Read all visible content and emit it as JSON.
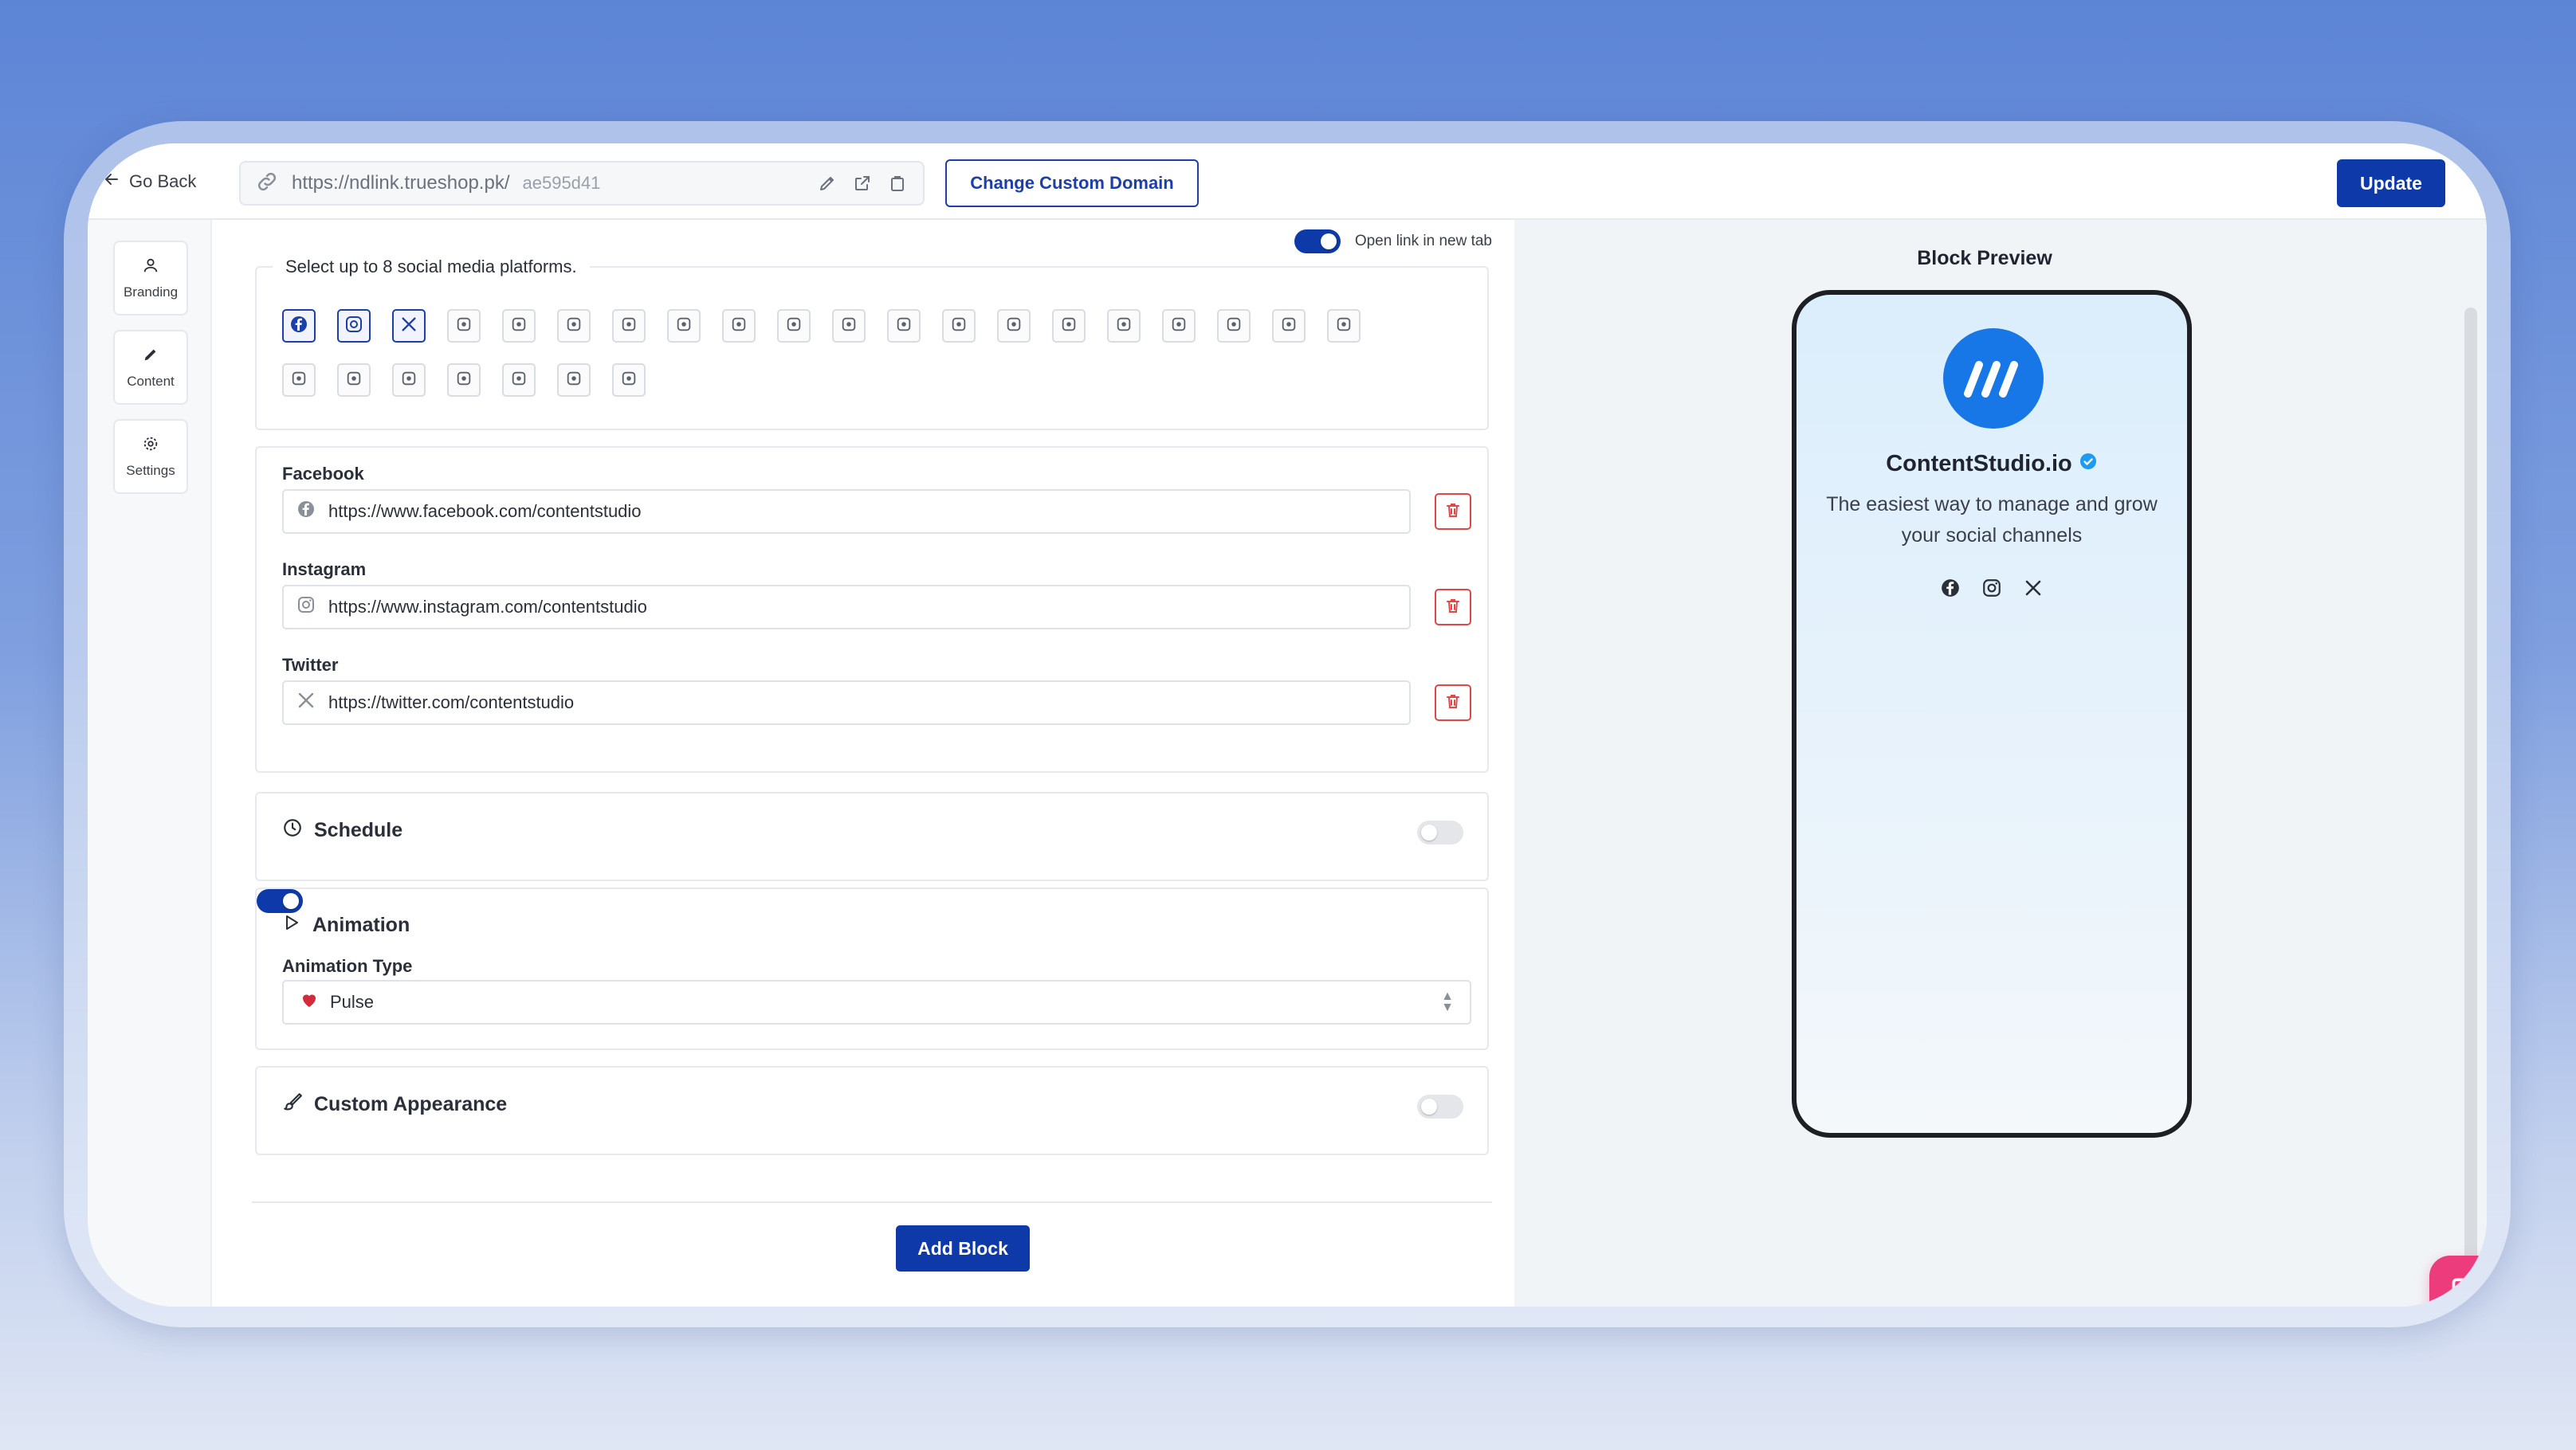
{
  "topbar": {
    "go_back": "Go Back",
    "url_base": "https://ndlink.trueshop.pk/",
    "url_slug": "ae595d41",
    "change_domain": "Change Custom Domain",
    "update": "Update"
  },
  "rail": {
    "items": [
      {
        "label": "Branding",
        "icon": "user-icon"
      },
      {
        "label": "Content",
        "icon": "pencil-icon"
      },
      {
        "label": "Settings",
        "icon": "gear-icon"
      }
    ]
  },
  "editor": {
    "open_new_tab": "Open link in new tab",
    "open_new_tab_on": true,
    "platforms_legend": "Select up to 8 social media platforms.",
    "platforms": [
      {
        "icon": "facebook-icon",
        "selected": true
      },
      {
        "icon": "instagram-icon",
        "selected": true
      },
      {
        "icon": "x-icon",
        "selected": true
      },
      {
        "icon": "linkedin-icon",
        "selected": false
      },
      {
        "icon": "youtube-icon",
        "selected": false
      },
      {
        "icon": "tiktok-icon",
        "selected": false
      },
      {
        "icon": "medium-icon",
        "selected": false
      },
      {
        "icon": "twitch-icon",
        "selected": false
      },
      {
        "icon": "spotify-icon",
        "selected": false
      },
      {
        "icon": "soundcloud-icon",
        "selected": false
      },
      {
        "icon": "apple-icon",
        "selected": false
      },
      {
        "icon": "pinterest-icon",
        "selected": false
      },
      {
        "icon": "snapchat-icon",
        "selected": false
      },
      {
        "icon": "reddit-icon",
        "selected": false
      },
      {
        "icon": "tumblr-icon",
        "selected": false
      },
      {
        "icon": "quora-icon",
        "selected": false
      },
      {
        "icon": "telegram-icon",
        "selected": false
      },
      {
        "icon": "discord-icon",
        "selected": false
      },
      {
        "icon": "slack-icon",
        "selected": false
      },
      {
        "icon": "line-icon",
        "selected": false
      },
      {
        "icon": "signal-icon",
        "selected": false
      },
      {
        "icon": "messenger-icon",
        "selected": false
      },
      {
        "icon": "wechat-icon",
        "selected": false
      },
      {
        "icon": "skype-icon",
        "selected": false
      },
      {
        "icon": "vimeo-icon",
        "selected": false
      },
      {
        "icon": "substack-icon",
        "selected": false
      },
      {
        "icon": "flickr-icon",
        "selected": false
      }
    ],
    "links": [
      {
        "label": "Facebook",
        "icon": "facebook-icon",
        "value": "https://www.facebook.com/contentstudio"
      },
      {
        "label": "Instagram",
        "icon": "instagram-icon",
        "value": "https://www.instagram.com/contentstudio"
      },
      {
        "label": "Twitter",
        "icon": "x-icon",
        "value": "https://twitter.com/contentstudio"
      }
    ],
    "schedule": {
      "label": "Schedule",
      "on": false
    },
    "animation": {
      "label": "Animation",
      "on": true,
      "type_label": "Animation Type",
      "type_value": "Pulse"
    },
    "custom_appearance": {
      "label": "Custom Appearance",
      "on": false
    },
    "add_block": "Add Block"
  },
  "preview": {
    "title": "Block Preview",
    "brand_name": "ContentStudio.io",
    "tagline": "The easiest way to manage and grow your social channels"
  },
  "colors": {
    "primary": "#0d3aa8",
    "danger": "#e04747",
    "brand_blue": "#1877e6",
    "chat": "#ec3c7c"
  }
}
